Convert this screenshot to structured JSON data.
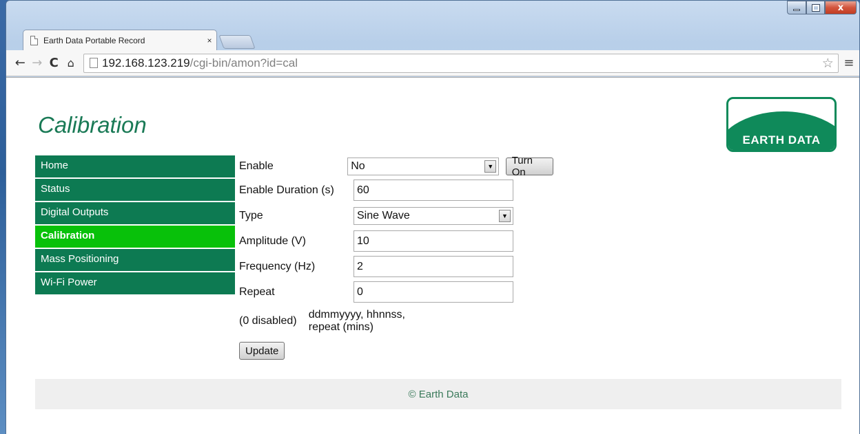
{
  "browser": {
    "tab_title": "Earth Data Portable Record",
    "tab_close": "×",
    "url_host": "192.168.123.219",
    "url_path": "/cgi-bin/amon?id=cal",
    "icons": {
      "back": "←",
      "forward": "→",
      "reload": "C",
      "home": "⌂",
      "star": "☆",
      "menu": "≡",
      "close": "x"
    }
  },
  "page": {
    "title": "Calibration",
    "logo_text": "EARTH DATA",
    "footer": "© Earth Data"
  },
  "sidebar": {
    "items": [
      {
        "label": "Home",
        "active": false
      },
      {
        "label": "Status",
        "active": false
      },
      {
        "label": "Digital Outputs",
        "active": false
      },
      {
        "label": "Calibration",
        "active": true
      },
      {
        "label": "Mass Positioning",
        "active": false
      },
      {
        "label": "Wi-Fi Power",
        "active": false
      }
    ]
  },
  "form": {
    "enable": {
      "label": "Enable",
      "value": "No",
      "button": "Turn On"
    },
    "duration": {
      "label": "Enable Duration (s)",
      "value": "60"
    },
    "type": {
      "label": "Type",
      "value": "Sine Wave"
    },
    "amplitude": {
      "label": "Amplitude (V)",
      "value": "10"
    },
    "frequency": {
      "label": "Frequency (Hz)",
      "value": "2"
    },
    "repeat": {
      "label": "Repeat",
      "value": "0",
      "note": "(0 disabled)",
      "hint": "ddmmyyyy, hhnnss, repeat (mins)"
    },
    "update_button": "Update"
  },
  "colors": {
    "nav_bg": "#0d7a52",
    "nav_active": "#08c10a",
    "title": "#1a7a56"
  }
}
